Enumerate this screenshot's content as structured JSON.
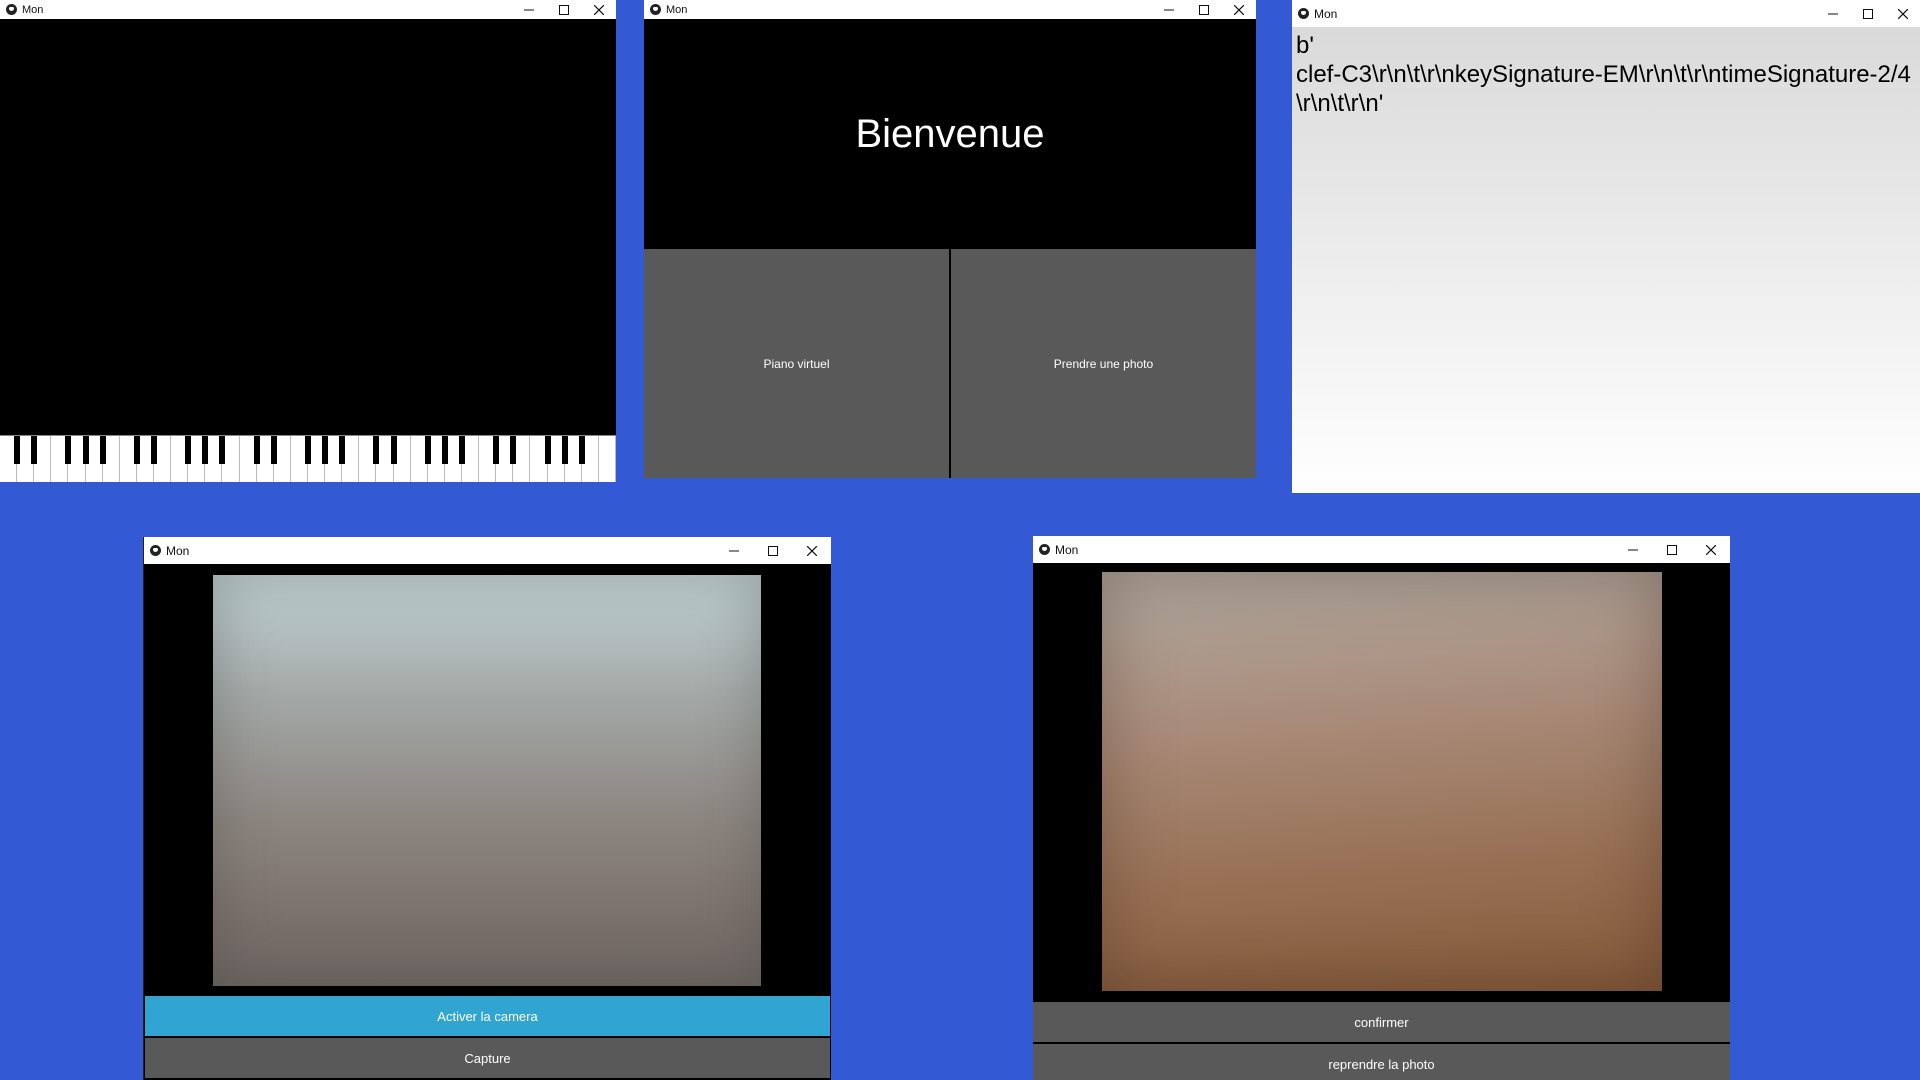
{
  "windows": {
    "piano": {
      "title": "Mon"
    },
    "home": {
      "title": "Mon",
      "heading": "Bienvenue",
      "buttons": {
        "piano": "Piano virtuel",
        "photo": "Prendre une photo"
      }
    },
    "output": {
      "title": "Mon",
      "text": "b'\nclef-C3\\r\\n\\t\\r\\nkeySignature-EM\\r\\n\\t\\r\\ntimeSignature-2/4\\r\\n\\t\\r\\n'"
    },
    "camera": {
      "title": "Mon",
      "buttons": {
        "activate": "Activer la camera",
        "capture": "Capture"
      }
    },
    "confirm": {
      "title": "Mon",
      "buttons": {
        "confirm": "confirmer",
        "retake": "reprendre la photo"
      }
    }
  },
  "colors": {
    "desktop": "#3359d4",
    "button_gray": "#595959",
    "button_accent": "#31a5d1"
  },
  "icons": [
    "app-icon",
    "minimize-icon",
    "maximize-icon",
    "close-icon"
  ]
}
